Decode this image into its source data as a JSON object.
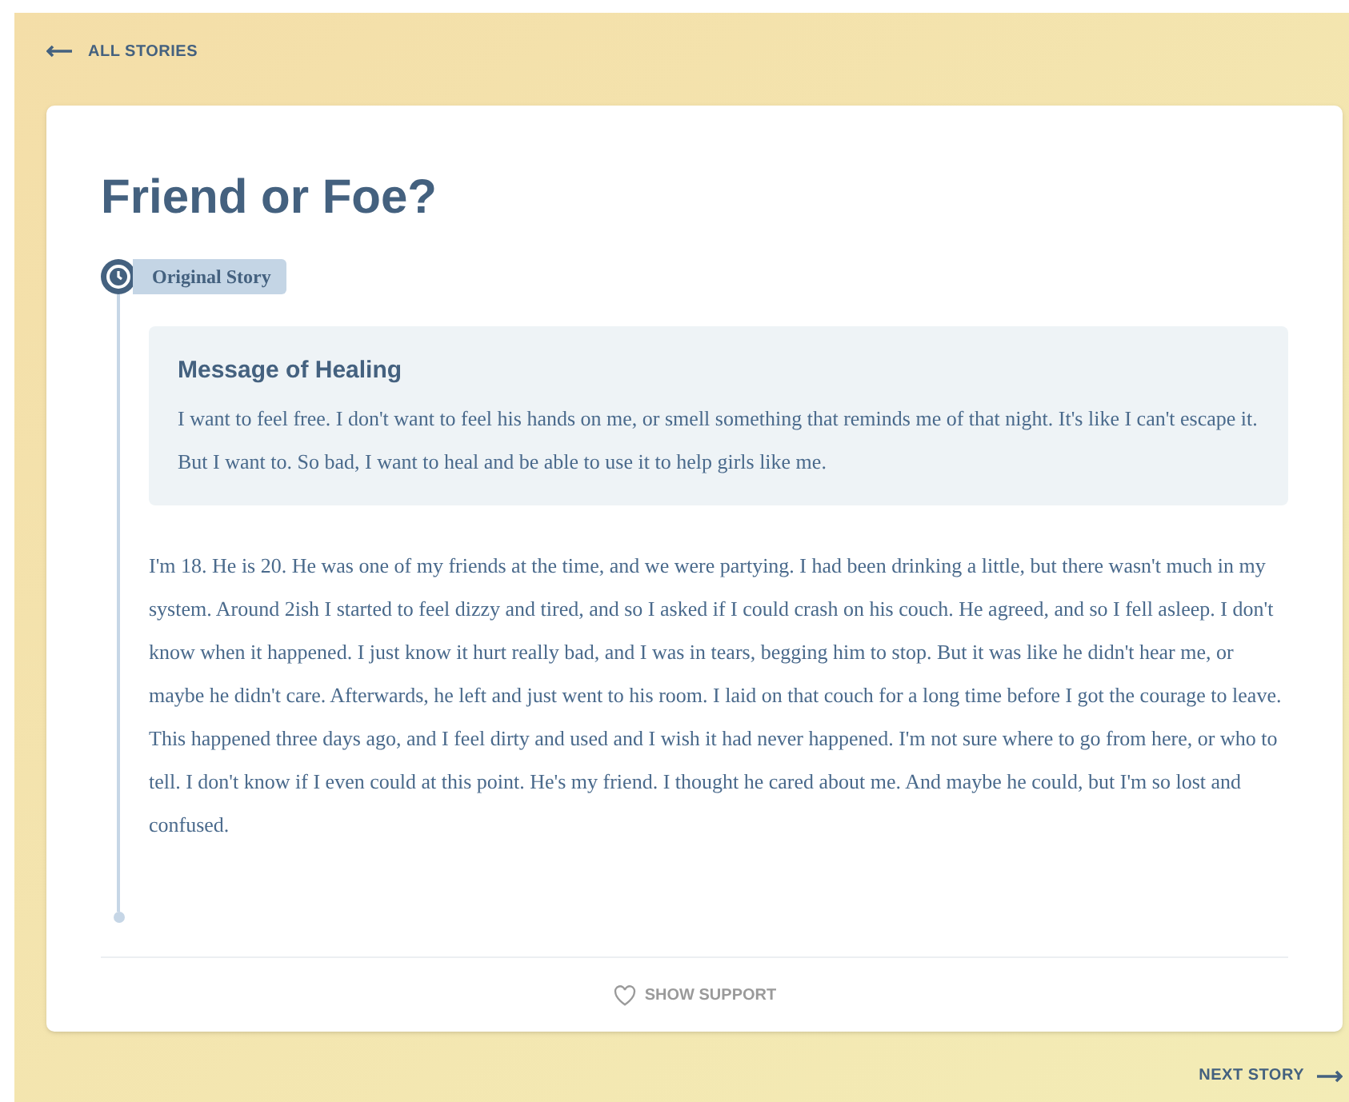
{
  "back_link": {
    "label": "ALL STORIES"
  },
  "story": {
    "title": "Friend or Foe?",
    "timeline_badge": {
      "label": "Original Story"
    },
    "message": {
      "heading": "Message of Healing",
      "text": "I want to feel free. I don't want to feel his hands on me, or smell something that reminds me of that night. It's like I can't escape it. But I want to. So bad, I want to heal and be able to use it to help girls like me."
    },
    "body": "I'm 18. He is 20. He was one of my friends at the time, and we were partying. I had been drinking a little, but there wasn't much in my system. Around 2ish I started to feel dizzy and tired, and so I asked if I could crash on his couch. He agreed, and so I fell asleep. I don't know when it happened. I just know it hurt really bad, and I was in tears, begging him to stop. But it was like he didn't hear me, or maybe he didn't care. Afterwards, he left and just went to his room. I laid on that couch for a long time before I got the courage to leave. This happened three days ago, and I feel dirty and used and I wish it had never happened. I'm not sure where to go from here, or who to tell. I don't know if I even could at this point. He's my friend. I thought he cared about me. And maybe he could, but I'm so lost and confused.",
    "support_button": {
      "label": "SHOW SUPPORT"
    }
  },
  "next_link": {
    "label": "NEXT STORY"
  }
}
